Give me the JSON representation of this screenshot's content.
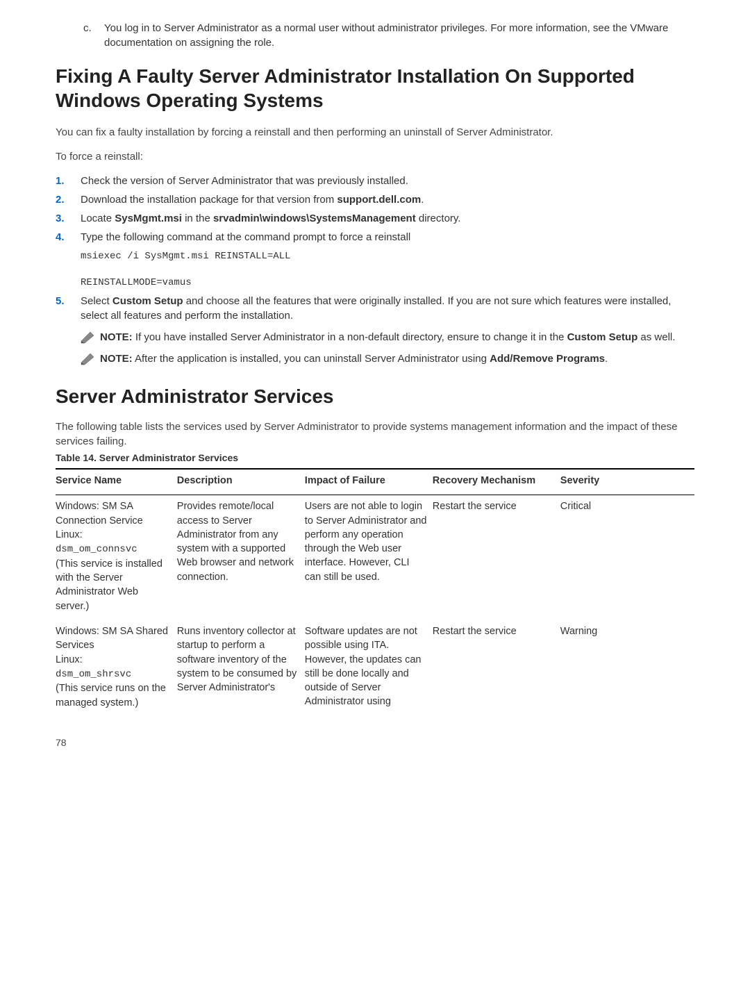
{
  "intro_item": {
    "letter": "c.",
    "text_1": "You log in to Server Administrator as a normal user without administrator privileges. For more information, see the VMware documentation on assigning the role."
  },
  "heading_fixing": "Fixing A Faulty Server Administrator Installation On Supported Windows Operating Systems",
  "fixing_intro": "You can fix a faulty installation by forcing a reinstall and then performing an uninstall of Server Administrator.",
  "force_label": "To force a reinstall:",
  "steps": {
    "1": "Check the version of Server Administrator that was previously installed.",
    "2_prefix": "Download the installation package for that version from ",
    "2_bold": "support.dell.com",
    "2_suffix": ".",
    "3_prefix": "Locate ",
    "3_b1": "SysMgmt.msi",
    "3_mid": " in the ",
    "3_b2": "srvadmin\\windows\\SystemsManagement",
    "3_suffix": " directory.",
    "4": "Type the following command at the command prompt to force a reinstall",
    "4_cmd1": "msiexec /i SysMgmt.msi REINSTALL=ALL",
    "4_cmd2": "REINSTALLMODE=vamus",
    "5_prefix": "Select ",
    "5_b1": "Custom Setup",
    "5_suffix": " and choose all the features that were originally installed. If you are not sure which features were installed, select all features and perform the installation."
  },
  "note1_prefix": "NOTE:",
  "note1_text_a": " If you have installed Server Administrator in a non-default directory, ensure to change it in the ",
  "note1_bold": "Custom Setup",
  "note1_text_b": " as well.",
  "note2_prefix": "NOTE:",
  "note2_text_a": " After the application is installed, you can uninstall Server Administrator using ",
  "note2_bold": "Add/Remove Programs",
  "note2_text_b": ".",
  "heading_services": "Server Administrator Services",
  "services_intro": "The following table lists the services used by Server Administrator to provide systems management information and the impact of these services failing.",
  "table_caption": "Table 14. Server Administrator Services",
  "table_headers": {
    "c1": "Service Name",
    "c2": "Description",
    "c3": "Impact of Failure",
    "c4": "Recovery Mechanism",
    "c5": "Severity"
  },
  "row1": {
    "svc_a": "Windows: SM SA Connection Service",
    "svc_b": "Linux:",
    "svc_mono": "dsm_om_connsvc",
    "svc_c": "(This service is installed with the Server Administrator Web server.)",
    "desc": "Provides remote/local access to Server Administrator from any system with a supported Web browser and network connection.",
    "impact": "Users are not able to login to Server Administrator and perform any operation through the Web user interface. However, CLI can still be used.",
    "recovery": "Restart the service",
    "severity": "Critical"
  },
  "row2": {
    "svc_a": "Windows: SM SA Shared Services",
    "svc_b": "Linux:",
    "svc_mono": "dsm_om_shrsvc",
    "svc_c": "(This service runs on the managed system.)",
    "desc": "Runs inventory collector at startup to perform a software inventory of the system to be consumed by Server Administrator's",
    "impact": "Software updates are not possible using ITA. However, the updates can still be done locally and outside of Server Administrator using",
    "recovery": "Restart the service",
    "severity": "Warning"
  },
  "page_number": "78"
}
